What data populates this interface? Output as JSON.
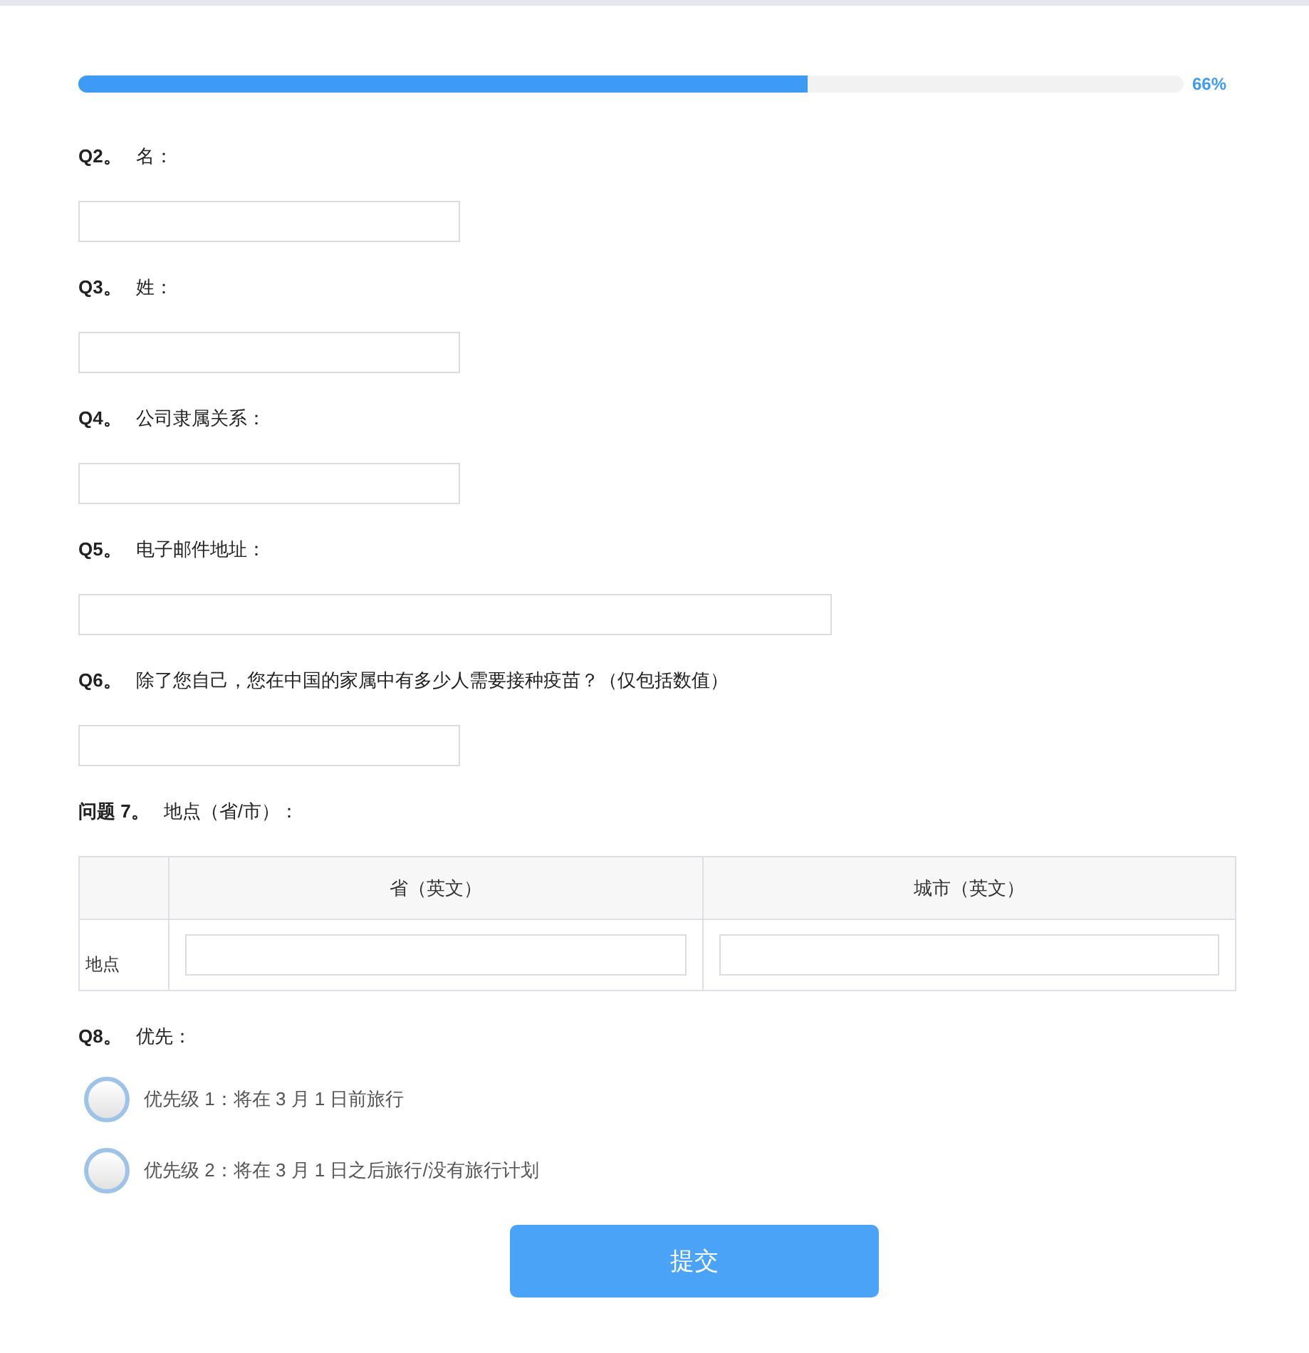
{
  "progress": {
    "level": 0.66,
    "reading": "66%"
  },
  "questions": [
    {
      "kind": "text",
      "number": "Q2。",
      "label": "名："
    },
    {
      "kind": "text",
      "number": "Q3。",
      "label": "姓："
    },
    {
      "kind": "text",
      "number": "Q4。",
      "label": "公司隶属关系："
    },
    {
      "kind": "email",
      "number": "Q5。",
      "label": "电子邮件地址："
    },
    {
      "kind": "text",
      "number": "Q6。",
      "label": "除了您自己，您在中国的家属中有多少人需要接种疫苗？（仅包括数值）"
    },
    {
      "kind": "table",
      "number": "问题 7。",
      "label": "地点（省/市）：",
      "columns": [
        "省（英文）",
        "城市（英文）"
      ],
      "rows": [
        {
          "label": "地点"
        }
      ]
    },
    {
      "kind": "radio",
      "number": "Q8。",
      "label": "优先：",
      "options": [
        {
          "label": "优先级 1：将在 3 月 1 日前旅行",
          "selected": false
        },
        {
          "label": "优先级 2：将在 3 月 1 日之后旅行/没有旅行计划",
          "selected": false
        }
      ]
    }
  ],
  "submit": "提交"
}
